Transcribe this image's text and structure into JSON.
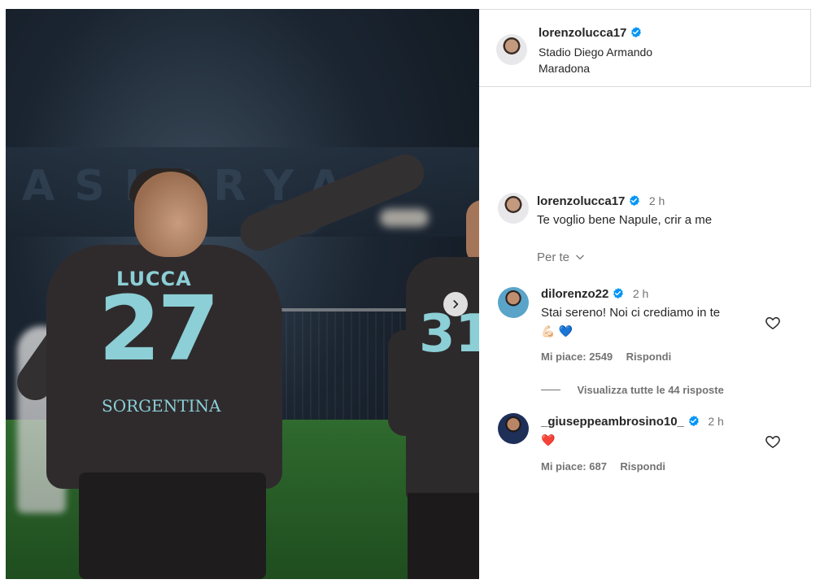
{
  "post": {
    "author": "lorenzolucca17",
    "location": "Stadio Diego Armando Maradona",
    "image": {
      "player_name": "LUCCA",
      "player_number": "27",
      "sponsor": "SORGENTINA",
      "teammate_number": "31"
    }
  },
  "caption": {
    "author": "lorenzolucca17",
    "time": "2 h",
    "text": "Te voglio bene Napule, crir a me"
  },
  "filter": {
    "label": "Per te"
  },
  "comments": [
    {
      "author": "dilorenzo22",
      "time": "2 h",
      "text": "Stai sereno! Noi ci crediamo in te",
      "emoji": "💪🏻 💙",
      "likes_label": "Mi piace: 2549",
      "reply_label": "Rispondi"
    },
    {
      "author": "_giuseppeambrosino10_",
      "time": "2 h",
      "emoji": "❤️",
      "likes_label": "Mi piace: 687",
      "reply_label": "Rispondi"
    }
  ],
  "replies_toggle": "Visualizza tutte le 44 risposte",
  "colors": {
    "verified": "#0095f6",
    "text": "#262626",
    "muted": "#737373",
    "border": "#dbdbdb",
    "jersey_accent": "#8ccfd6"
  },
  "icons": [
    "verified-badge-icon",
    "chevron-down-icon",
    "heart-outline-icon",
    "chevron-right-icon"
  ]
}
